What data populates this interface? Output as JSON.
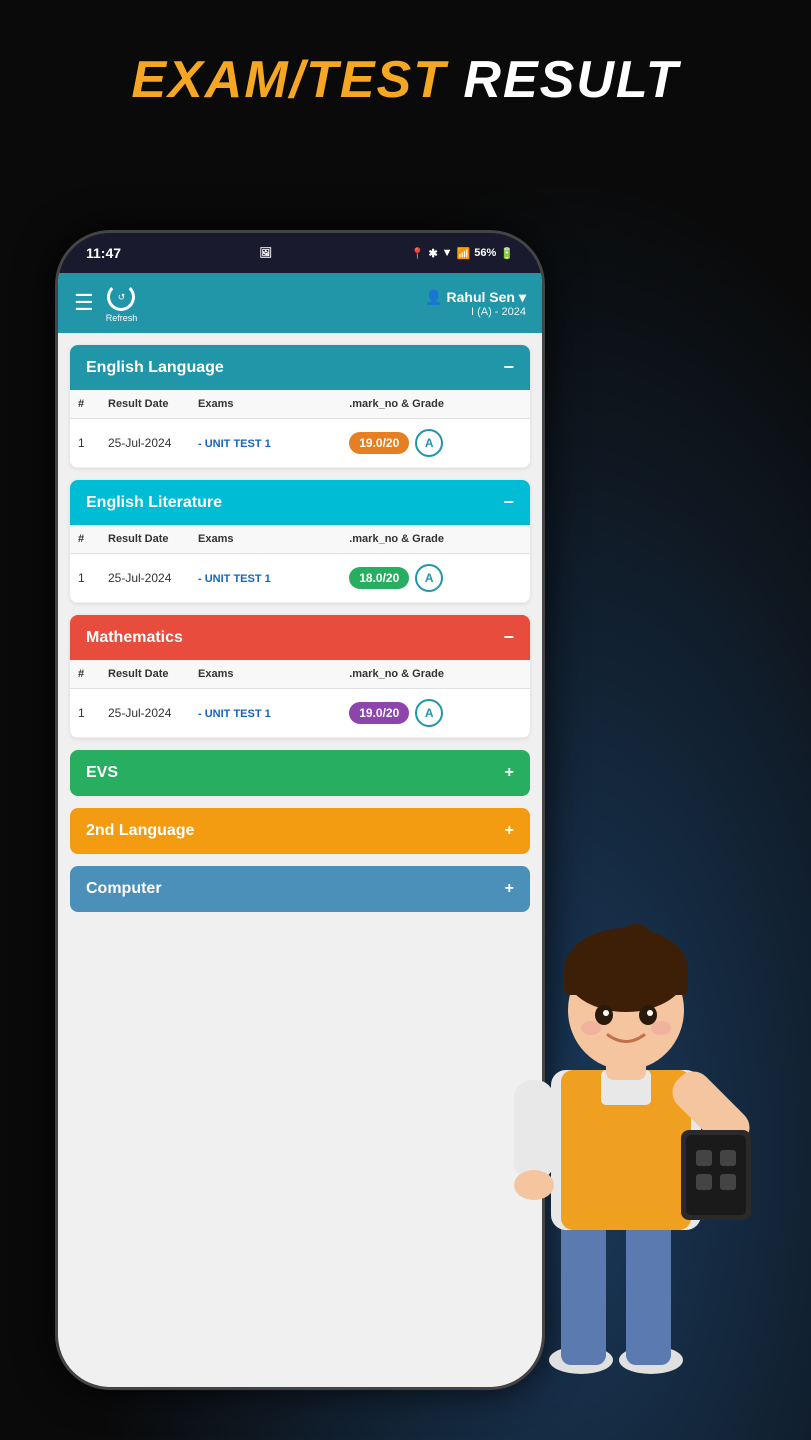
{
  "page": {
    "title_orange": "EXAM/TEST",
    "title_white": " RESULT"
  },
  "status_bar": {
    "time": "11:47",
    "battery": "56%",
    "signal_icons": "📍 * ▼ 📶"
  },
  "header": {
    "user_name": "Rahul Sen",
    "user_class": "I (A) - 2024",
    "refresh_label": "Refresh"
  },
  "subjects": [
    {
      "name": "English Language",
      "color": "blue",
      "toggle": "−",
      "expanded": true,
      "columns": [
        "#",
        "Result Date",
        "Exams",
        ".mark_no & Grade"
      ],
      "rows": [
        {
          "num": "1",
          "date": "25-Jul-2024",
          "exam": "- UNIT TEST 1",
          "mark": "19.0/20",
          "mark_color": "orange-bg",
          "grade": "A"
        }
      ]
    },
    {
      "name": "English Literature",
      "color": "cyan",
      "toggle": "−",
      "expanded": true,
      "columns": [
        "#",
        "Result Date",
        "Exams",
        ".mark_no & Grade"
      ],
      "rows": [
        {
          "num": "1",
          "date": "25-Jul-2024",
          "exam": "- UNIT TEST 1",
          "mark": "18.0/20",
          "mark_color": "green-bg",
          "grade": "A"
        }
      ]
    },
    {
      "name": "Mathematics",
      "color": "red",
      "toggle": "−",
      "expanded": true,
      "columns": [
        "#",
        "Result Date",
        "Exams",
        ".mark_no & Grade"
      ],
      "rows": [
        {
          "num": "1",
          "date": "25-Jul-2024",
          "exam": "- UNIT TEST 1",
          "mark": "19.0/20",
          "mark_color": "purple-bg",
          "grade": "A"
        }
      ]
    }
  ],
  "collapsed_sections": [
    {
      "name": "EVS",
      "color": "green",
      "toggle": "+"
    },
    {
      "name": "2nd Language",
      "color": "orange",
      "toggle": "+"
    },
    {
      "name": "Computer",
      "color": "steelblue",
      "toggle": "+"
    }
  ]
}
